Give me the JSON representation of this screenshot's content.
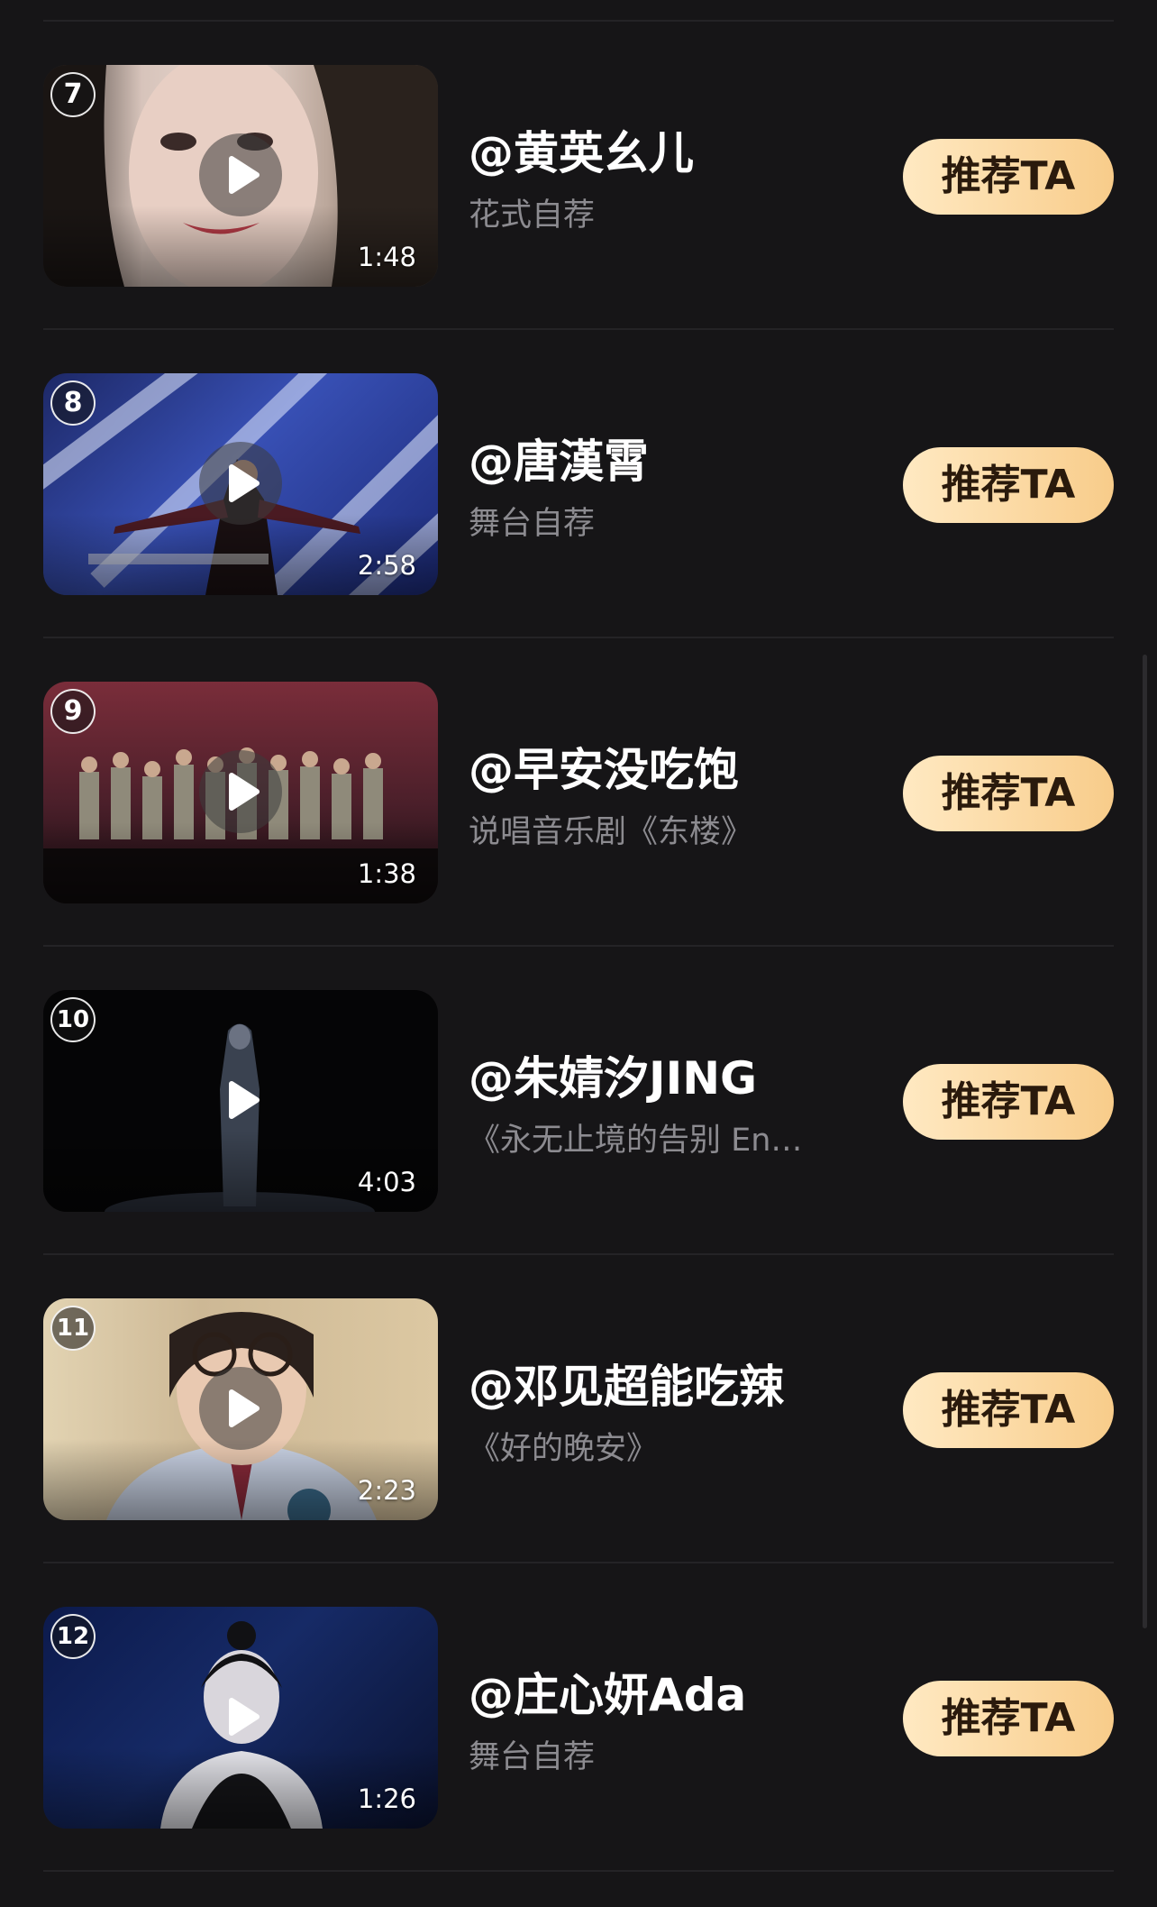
{
  "items": [
    {
      "rank": "7",
      "name": "@黄英幺儿",
      "desc": "花式自荐",
      "duration": "1:48",
      "button": "推荐TA"
    },
    {
      "rank": "8",
      "name": "@唐漢霄",
      "desc": "舞台自荐",
      "duration": "2:58",
      "button": "推荐TA"
    },
    {
      "rank": "9",
      "name": "@早安没吃饱",
      "desc": "说唱音乐剧《东楼》",
      "duration": "1:38",
      "button": "推荐TA"
    },
    {
      "rank": "10",
      "name": "@朱婧汐JING",
      "desc": "《永无止境的告别 En…",
      "duration": "4:03",
      "button": "推荐TA"
    },
    {
      "rank": "11",
      "name": "@邓见超能吃辣",
      "desc": "《好的晚安》",
      "duration": "2:23",
      "button": "推荐TA"
    },
    {
      "rank": "12",
      "name": "@庄心妍Ada",
      "desc": "舞台自荐",
      "duration": "1:26",
      "button": "推荐TA"
    }
  ],
  "icons": {
    "play": "play-icon"
  },
  "colors": {
    "background": "#161517",
    "button_gradient_start": "#ffe9c2",
    "button_gradient_end": "#f8cc8a",
    "button_text": "#2a1a0c",
    "secondary_text": "#8c8b90"
  }
}
